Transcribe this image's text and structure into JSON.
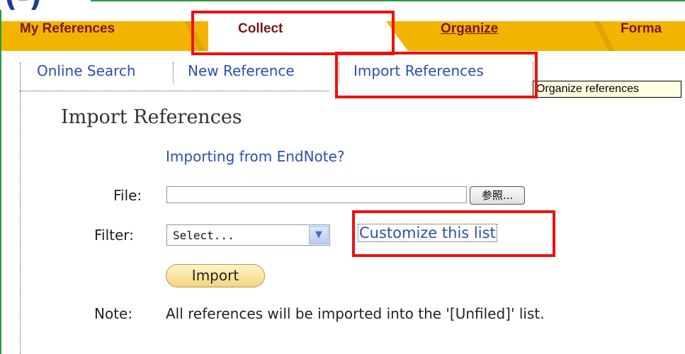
{
  "corner_label": "(-)",
  "tabs": [
    {
      "label": "My References"
    },
    {
      "label": "Collect"
    },
    {
      "label": "Organize"
    },
    {
      "label": "Forma"
    }
  ],
  "subnav": {
    "online_search": "Online Search",
    "new_reference": "New Reference",
    "import_references": "Import References"
  },
  "tooltip": "Organize references",
  "page_title": "Import References",
  "endnote_link": "Importing from EndNote?",
  "file": {
    "label": "File:",
    "value": "",
    "browse_label": "参照..."
  },
  "filter": {
    "label": "Filter:",
    "selected": "Select...",
    "customize_link": "Customize this list"
  },
  "import_button": "Import",
  "note": {
    "label": "Note:",
    "text": "All references will be imported into the '[Unfiled]' list."
  },
  "colors": {
    "tab_bar": "#f3b400",
    "tab_text": "#7a1818",
    "link": "#2b4fae",
    "highlight": "#ee1111",
    "frame": "#2a9a3a"
  }
}
